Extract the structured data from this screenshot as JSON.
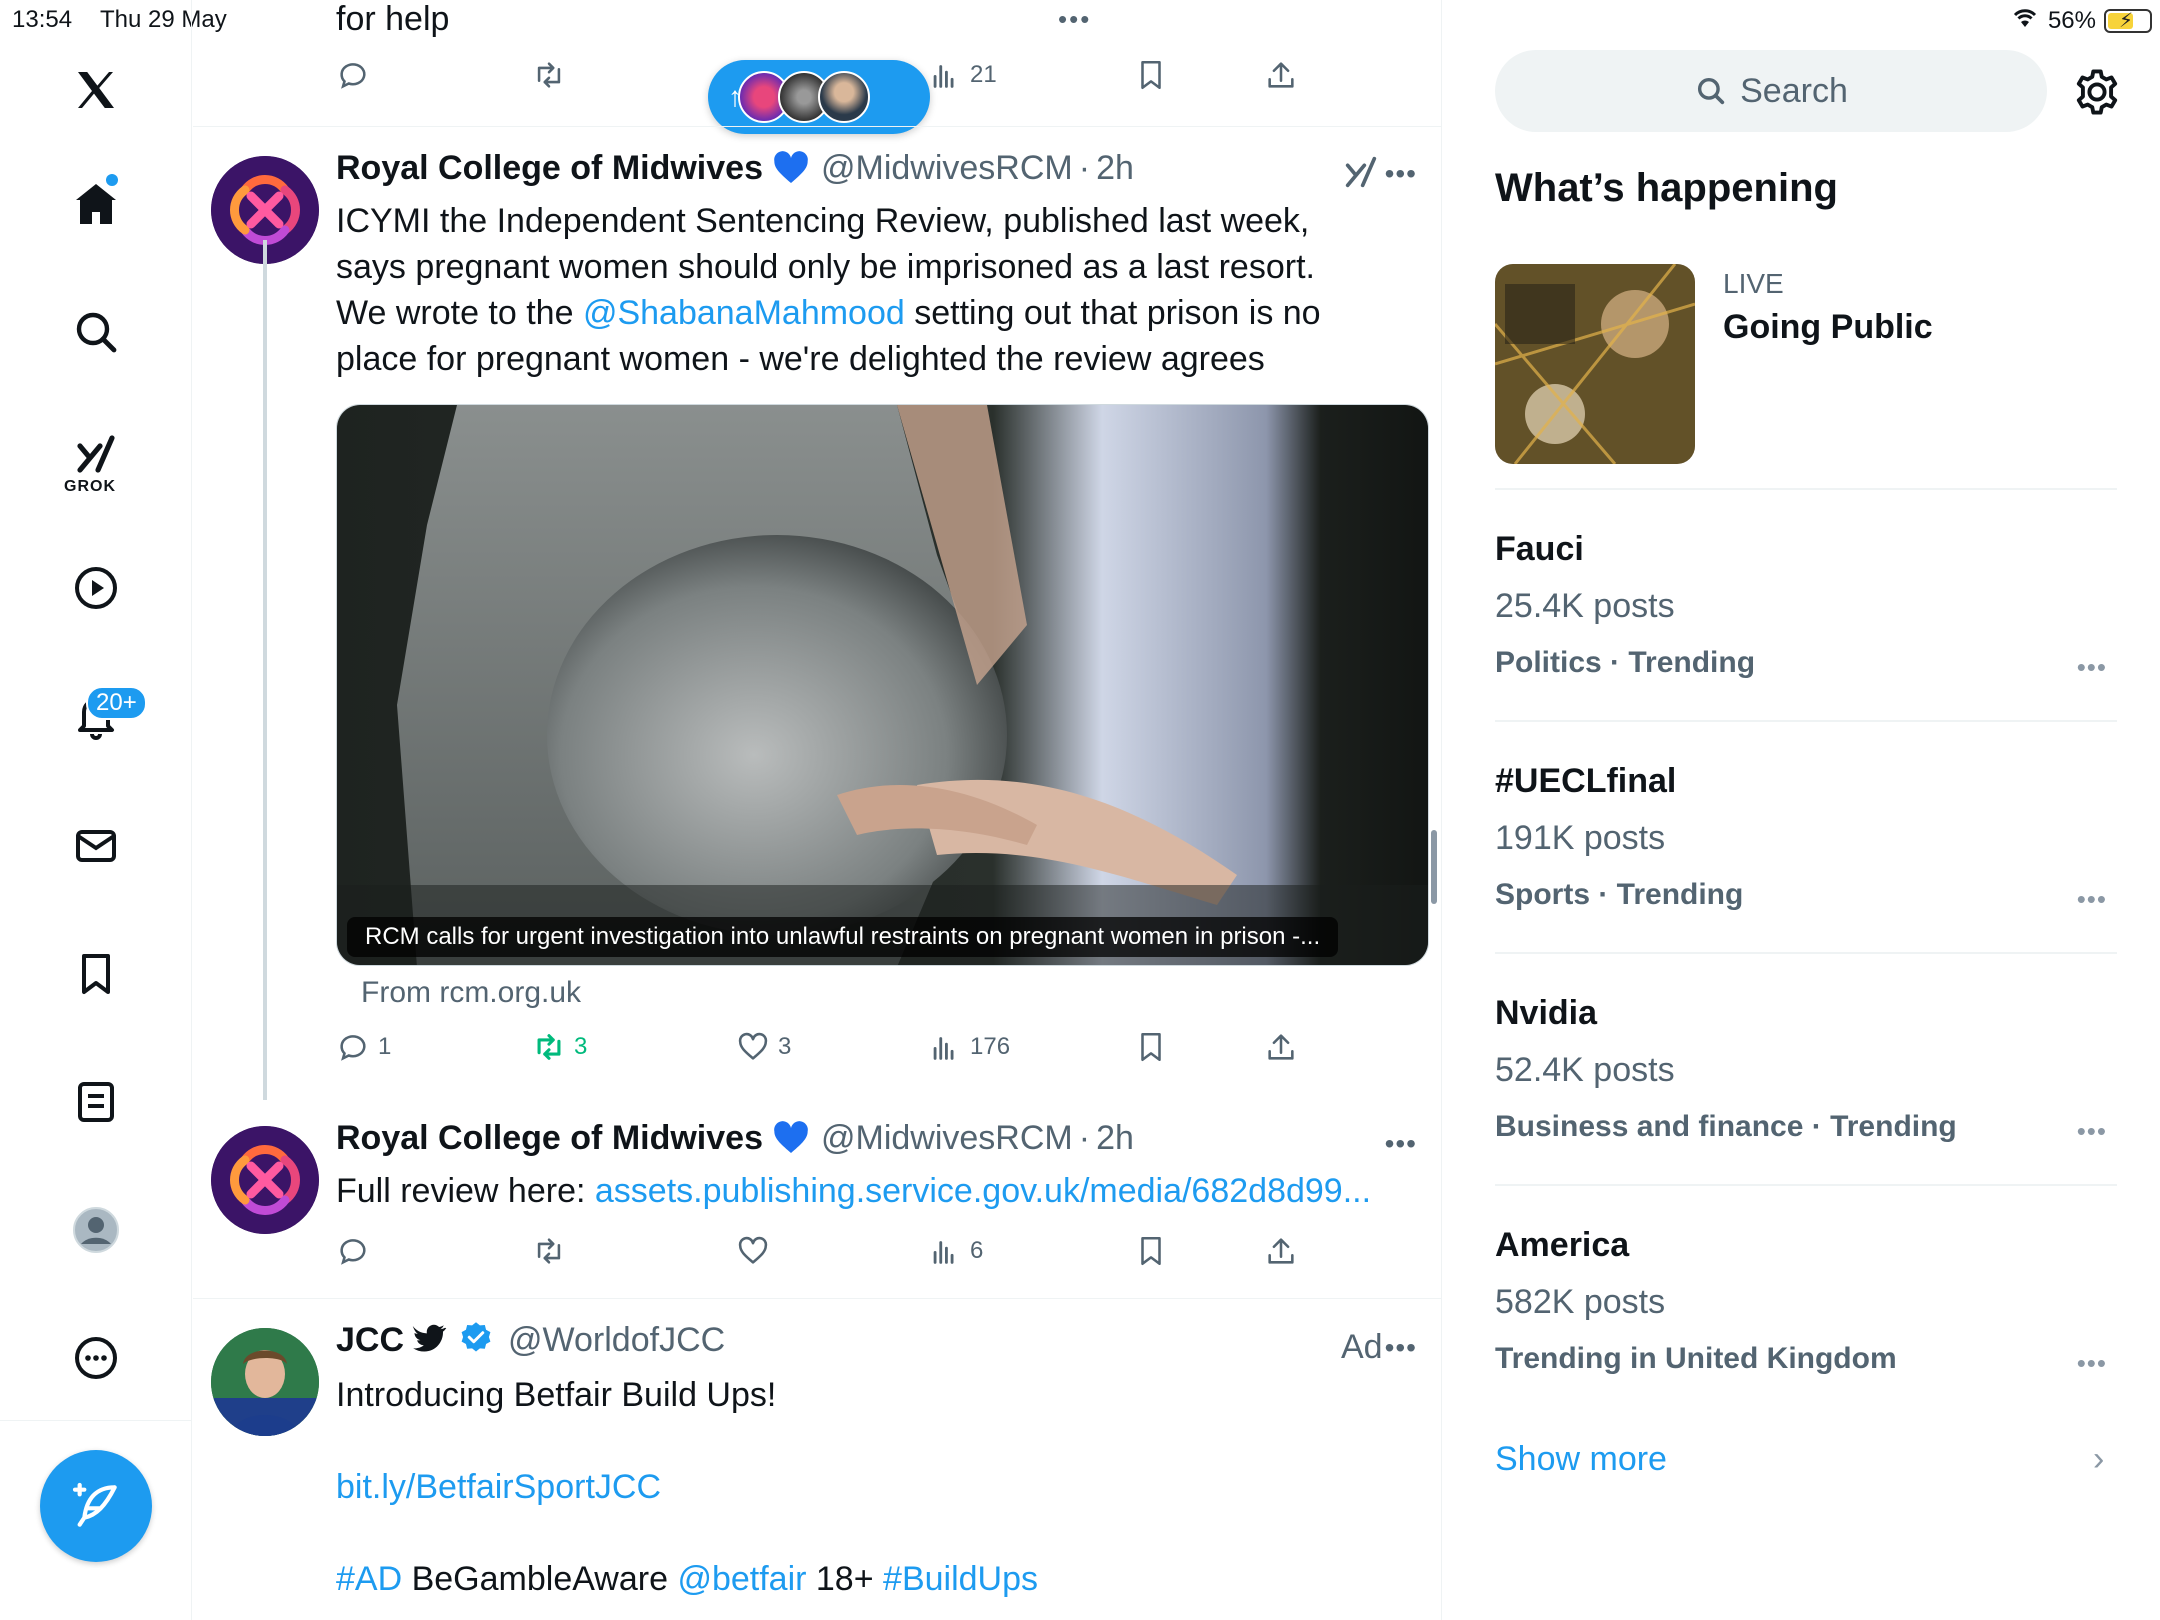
{
  "status": {
    "time": "13:54",
    "date": "Thu 29 May",
    "battery": "56%"
  },
  "nav": {
    "notif_badge": "20+",
    "grok_label": "GROK"
  },
  "feed": {
    "top_fragment": "for help",
    "top_actions": {
      "views": "21"
    },
    "post1": {
      "name": "Royal College of Midwives",
      "handle": "@MidwivesRCM",
      "sep": "·",
      "time": "2h",
      "text_a": "ICYMI the Independent Sentencing Review, published last week, says pregnant women should only be imprisoned as a last resort. We wrote to the ",
      "mention": "@ShabanaMahmood",
      "text_b": " setting out that prison is no place for pregnant women - we're delighted the review agrees",
      "media_caption": "RCM calls for urgent investigation into unlawful restraints on pregnant women in prison  -...",
      "from": "From rcm.org.uk",
      "replies": "1",
      "reposts": "3",
      "likes": "3",
      "views": "176"
    },
    "post2": {
      "name": "Royal College of Midwives",
      "handle": "@MidwivesRCM",
      "sep": "·",
      "time": "2h",
      "text": "Full review here: ",
      "link": "assets.publishing.service.gov.uk/media/682d8d99...",
      "views": "6"
    },
    "post3": {
      "name": "JCC",
      "handle": "@WorldofJCC",
      "ad": "Ad",
      "line1": "Introducing Betfair Build Ups!",
      "link": "bit.ly/BetfairSportJCC",
      "tag1": "#AD",
      "mid1": " BeGambleAware ",
      "mention": "@betfair",
      "mid2": " 18+ ",
      "tag2": "#BuildUps"
    }
  },
  "sidebar": {
    "search_placeholder": "Search",
    "heading": "What’s happening",
    "live": {
      "tag": "LIVE",
      "title": "Going Public"
    },
    "trends": [
      {
        "name": "Fauci",
        "posts": "25.4K posts",
        "category": "Politics · Trending"
      },
      {
        "name": "#UECLfinal",
        "posts": "191K posts",
        "category": "Sports · Trending"
      },
      {
        "name": "Nvidia",
        "posts": "52.4K posts",
        "category": "Business and finance · Trending"
      },
      {
        "name": "America",
        "posts": "582K posts",
        "category": "Trending in United Kingdom"
      }
    ],
    "show_more": "Show more"
  },
  "colors": {
    "accent": "#1d9bf0",
    "repost_active": "#00ba7c",
    "text": "#0f1419",
    "muted": "#536471"
  }
}
